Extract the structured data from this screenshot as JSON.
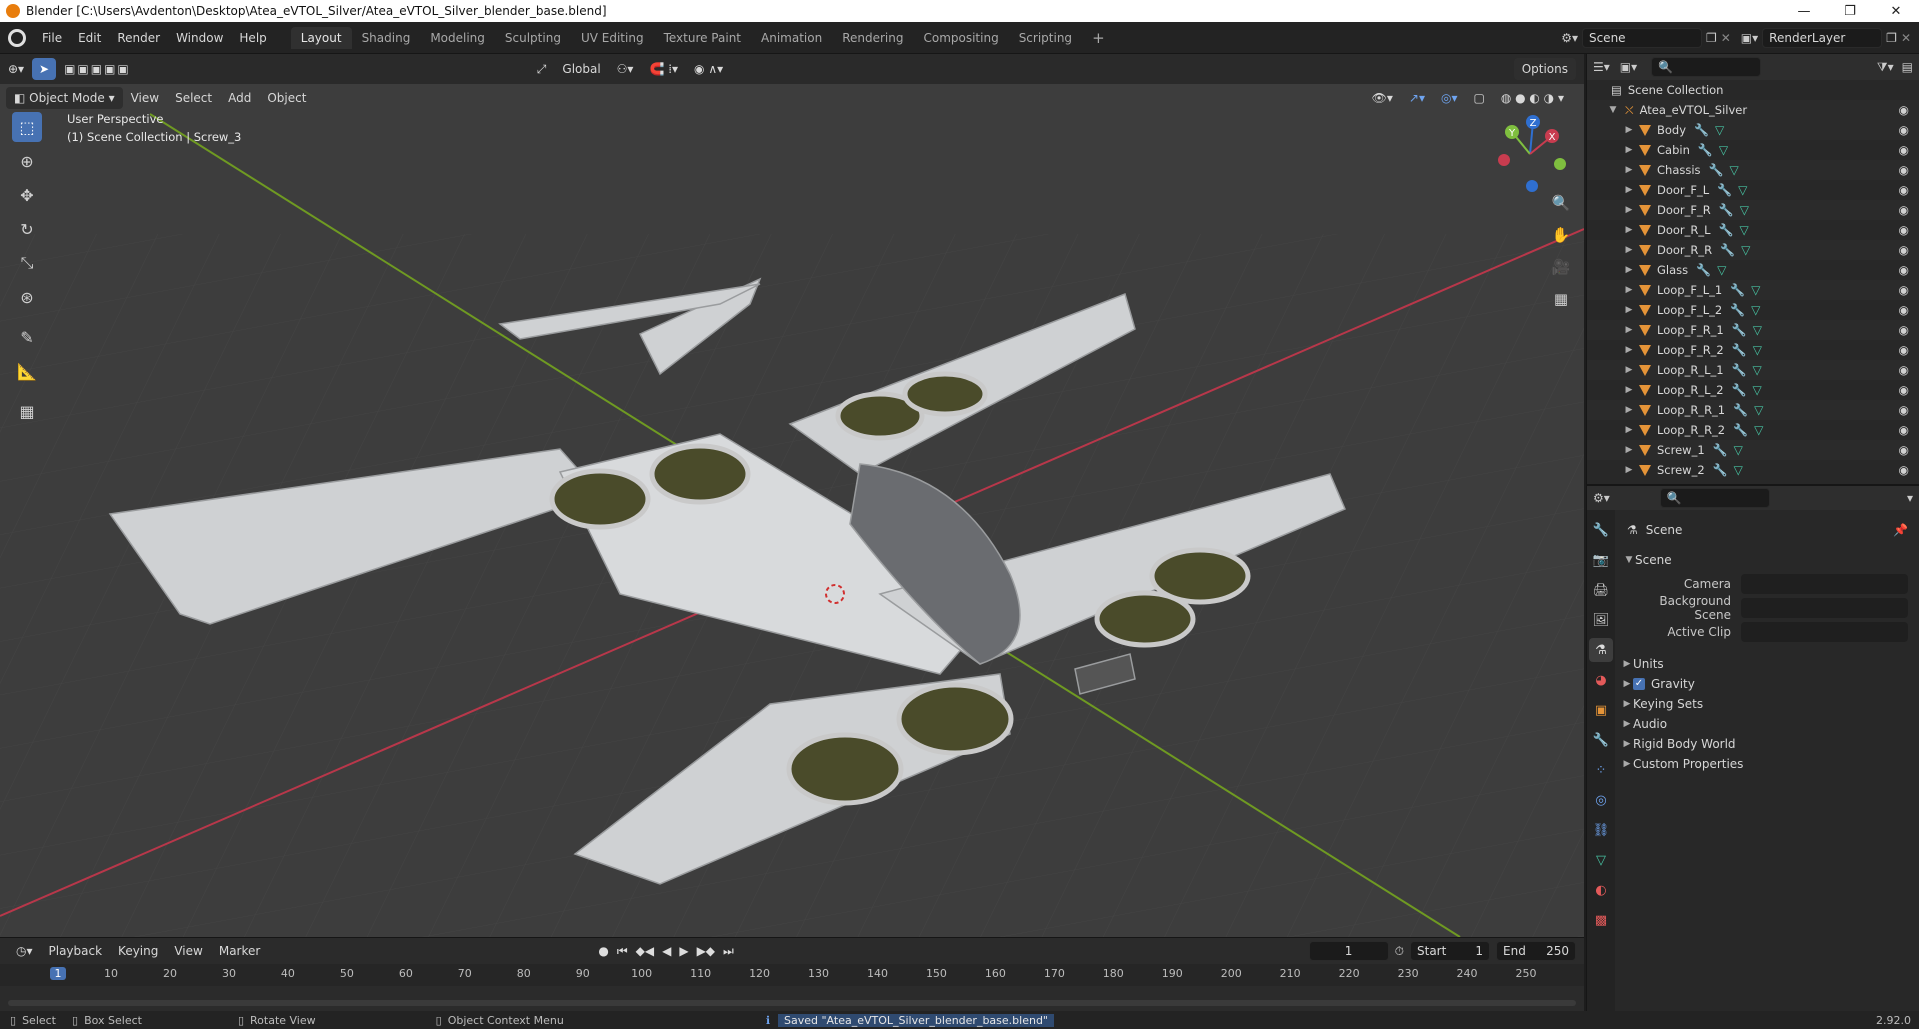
{
  "window": {
    "title": "Blender [C:\\Users\\Avdenton\\Desktop\\Atea_eVTOL_Silver/Atea_eVTOL_Silver_blender_base.blend]",
    "controls": [
      "—",
      "❐",
      "✕"
    ]
  },
  "menu": [
    "File",
    "Edit",
    "Render",
    "Window",
    "Help"
  ],
  "workspaces": [
    "Layout",
    "Shading",
    "Modeling",
    "Sculpting",
    "UV Editing",
    "Texture Paint",
    "Animation",
    "Rendering",
    "Compositing",
    "Scripting"
  ],
  "active_workspace": "Layout",
  "scene_field": "Scene",
  "renderlayer_field": "RenderLayer",
  "viewport": {
    "transform_orientation": "Global",
    "options_label": "Options",
    "mode": "Object Mode",
    "header_menus": [
      "View",
      "Select",
      "Add",
      "Object"
    ],
    "overlay_line1": "User Perspective",
    "overlay_line2": "(1) Scene Collection | Screw_3",
    "gizmo_labels": {
      "z": "Z",
      "y": "Y",
      "x": "X"
    }
  },
  "timeline": {
    "menus": [
      "Playback",
      "Keying",
      "View",
      "Marker"
    ],
    "current_frame": "1",
    "start_label": "Start",
    "start": "1",
    "end_label": "End",
    "end": "250",
    "ruler": [
      "1",
      "10",
      "20",
      "30",
      "40",
      "50",
      "60",
      "70",
      "80",
      "90",
      "100",
      "110",
      "120",
      "130",
      "140",
      "150",
      "160",
      "170",
      "180",
      "190",
      "200",
      "210",
      "220",
      "230",
      "240",
      "250"
    ]
  },
  "outliner": {
    "root": "Scene Collection",
    "collection": "Atea_eVTOL_Silver",
    "objects": [
      "Body",
      "Cabin",
      "Chassis",
      "Door_F_L",
      "Door_F_R",
      "Door_R_L",
      "Door_R_R",
      "Glass",
      "Loop_F_L_1",
      "Loop_F_L_2",
      "Loop_F_R_1",
      "Loop_F_R_2",
      "Loop_R_L_1",
      "Loop_R_L_2",
      "Loop_R_R_1",
      "Loop_R_R_2",
      "Screw_1",
      "Screw_2"
    ]
  },
  "properties": {
    "context": "Scene",
    "panel_title": "Scene",
    "fields": [
      {
        "label": "Camera",
        "value": ""
      },
      {
        "label": "Background Scene",
        "value": ""
      },
      {
        "label": "Active Clip",
        "value": ""
      }
    ],
    "subpanels": [
      {
        "label": "Units",
        "checkbox": false
      },
      {
        "label": "Gravity",
        "checkbox": true
      },
      {
        "label": "Keying Sets",
        "checkbox": false
      },
      {
        "label": "Audio",
        "checkbox": false
      },
      {
        "label": "Rigid Body World",
        "checkbox": false
      },
      {
        "label": "Custom Properties",
        "checkbox": false
      }
    ]
  },
  "status": {
    "select": "Select",
    "box_select": "Box Select",
    "rotate": "Rotate View",
    "context_menu": "Object Context Menu",
    "message": "Saved \"Atea_eVTOL_Silver_blender_base.blend\"",
    "version": "2.92.0"
  },
  "colors": {
    "accent": "#4772b3",
    "viewport_bg": "#3d3d3d",
    "x_axis": "#b8374a",
    "y_axis": "#6f9a22",
    "mesh_icon": "#e59438"
  }
}
